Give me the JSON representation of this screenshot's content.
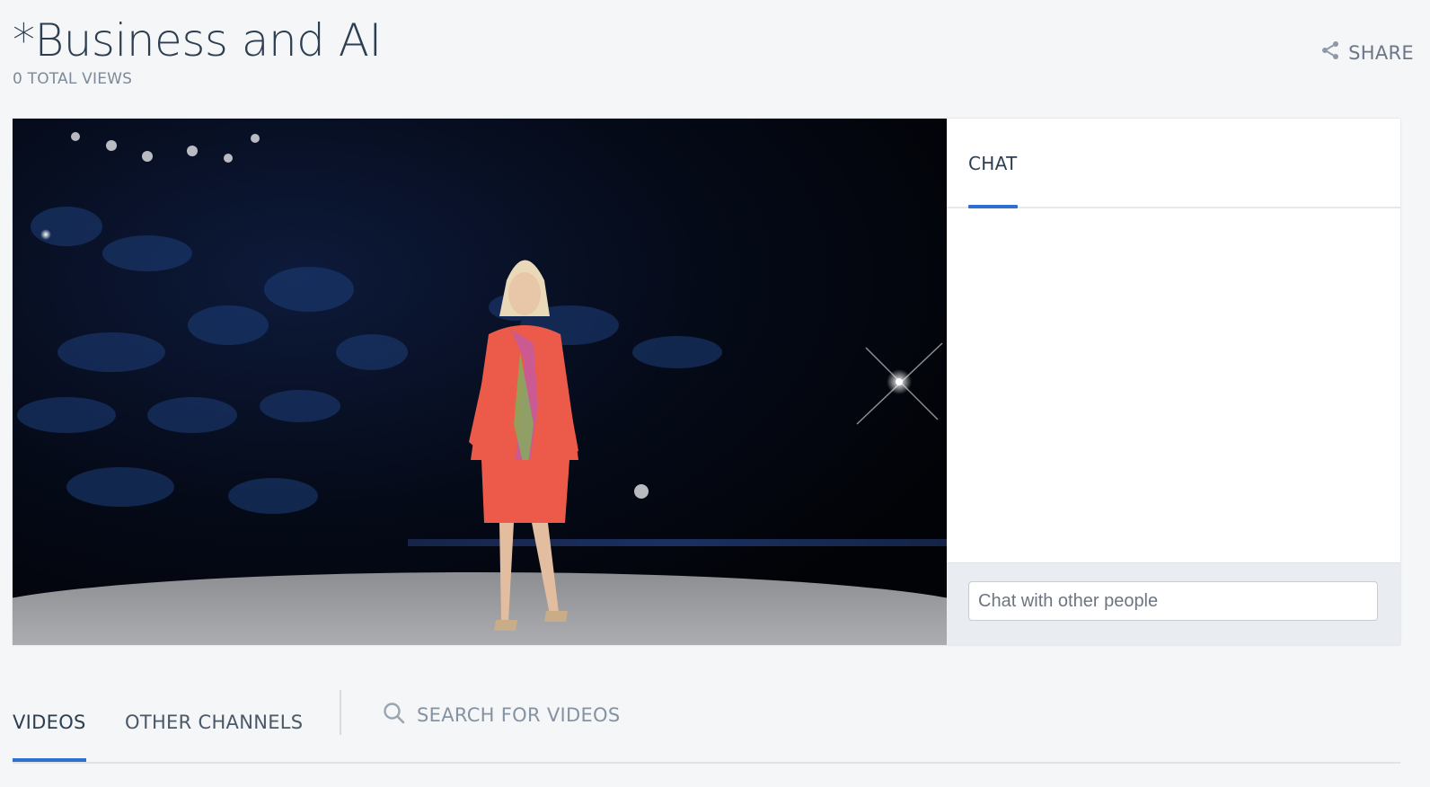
{
  "header": {
    "title": "*Business and AI",
    "views": "0 TOTAL VIEWS",
    "share_label": "SHARE"
  },
  "video": {
    "description_icon": "video-player"
  },
  "chat": {
    "tab_label": "CHAT",
    "input_placeholder": "Chat with other people"
  },
  "bottom_nav": {
    "tabs": [
      {
        "label": "VIDEOS",
        "active": true
      },
      {
        "label": "OTHER CHANNELS",
        "active": false
      }
    ],
    "search_placeholder": "SEARCH FOR VIDEOS"
  },
  "colors": {
    "accent": "#2f6fce",
    "title": "#2c3e50",
    "muted": "#7d8a99",
    "background": "#f4f6f8"
  }
}
